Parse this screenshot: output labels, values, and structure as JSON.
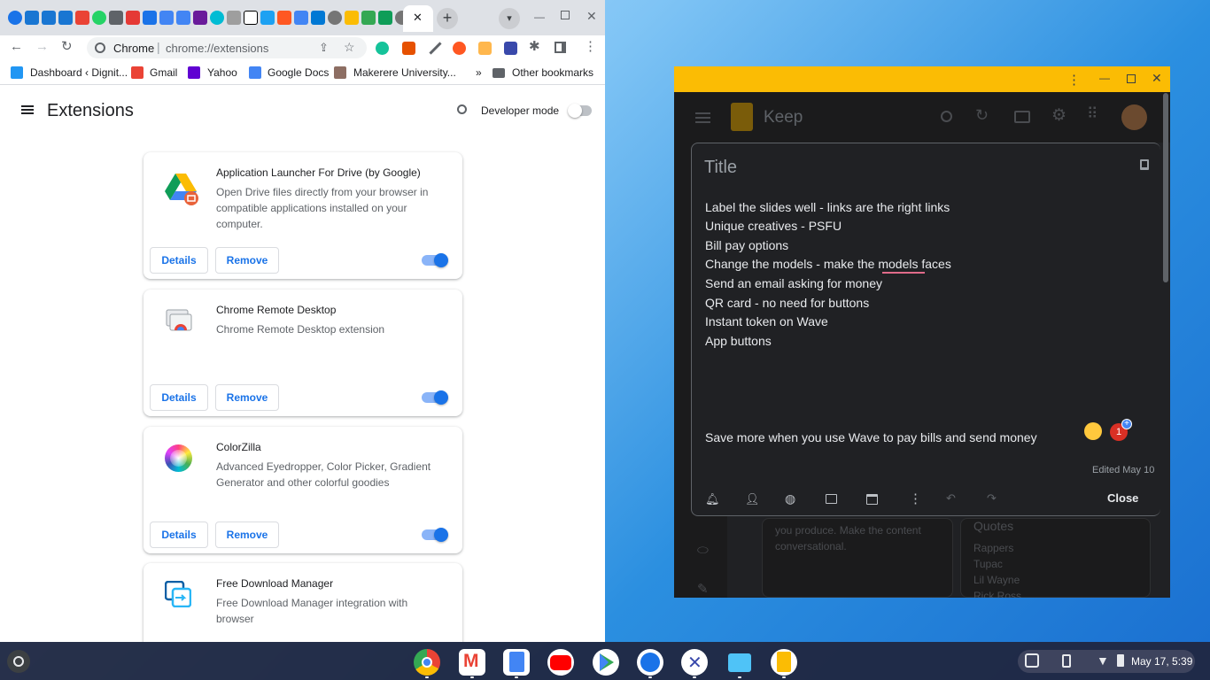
{
  "browser": {
    "omnibox_site": "Chrome",
    "omnibox_url": "chrome://extensions",
    "tab_close": "✕",
    "new_tab": "+",
    "bookmarks": [
      {
        "label": "Dashboard ‹ Dignit...",
        "icon": "dashboard-icon",
        "color": "#2196f3"
      },
      {
        "label": "Gmail",
        "icon": "gmail-icon",
        "color": "#ea4335"
      },
      {
        "label": "Yahoo",
        "icon": "yahoo-icon",
        "color": "#6001d2"
      },
      {
        "label": "Google Docs",
        "icon": "docs-icon",
        "color": "#4285f4"
      },
      {
        "label": "Makerere University...",
        "icon": "makerere-icon",
        "color": "#8d6e63"
      }
    ],
    "bookmarks_overflow": "»",
    "other_bookmarks": "Other bookmarks"
  },
  "extensions_page": {
    "title": "Extensions",
    "developer_mode_label": "Developer mode",
    "developer_mode_on": false,
    "cards": [
      {
        "name": "Application Launcher For Drive (by Google)",
        "description": "Open Drive files directly from your browser in compatible applications installed on your computer.",
        "enabled": true,
        "details": "Details",
        "remove": "Remove"
      },
      {
        "name": "Chrome Remote Desktop",
        "description": "Chrome Remote Desktop extension",
        "enabled": true,
        "details": "Details",
        "remove": "Remove"
      },
      {
        "name": "ColorZilla",
        "description": "Advanced Eyedropper, Color Picker, Gradient Generator and other colorful goodies",
        "enabled": true,
        "details": "Details",
        "remove": "Remove"
      },
      {
        "name": "Free Download Manager",
        "description": "Free Download Manager integration with browser"
      }
    ]
  },
  "keep": {
    "app_name": "Keep",
    "note_title_placeholder": "Title",
    "lines": [
      "Label the slides well - links are the right links",
      "Unique creatives - PSFU",
      "Bill pay options",
      "Change the models - make the models faces",
      "Send an email asking for money",
      "QR card - no need for buttons",
      "Instant token on Wave",
      "App buttons"
    ],
    "footer_line": "Save more when you use Wave to pay bills and send money",
    "badge_count": "1",
    "edited": "Edited May 10",
    "close_label": "Close",
    "background_note_text": "you produce. Make the content conversational.",
    "background_quotes_title": "Quotes",
    "background_quotes": [
      "Rappers",
      "Tupac",
      "Lil Wayne",
      "Rick Ross"
    ]
  },
  "system": {
    "datetime": "May 17, 5:39"
  },
  "colors": {
    "keep_yellow": "#fbbc04",
    "chrome_blue": "#1a73e8",
    "keep_dark": "#202124"
  }
}
